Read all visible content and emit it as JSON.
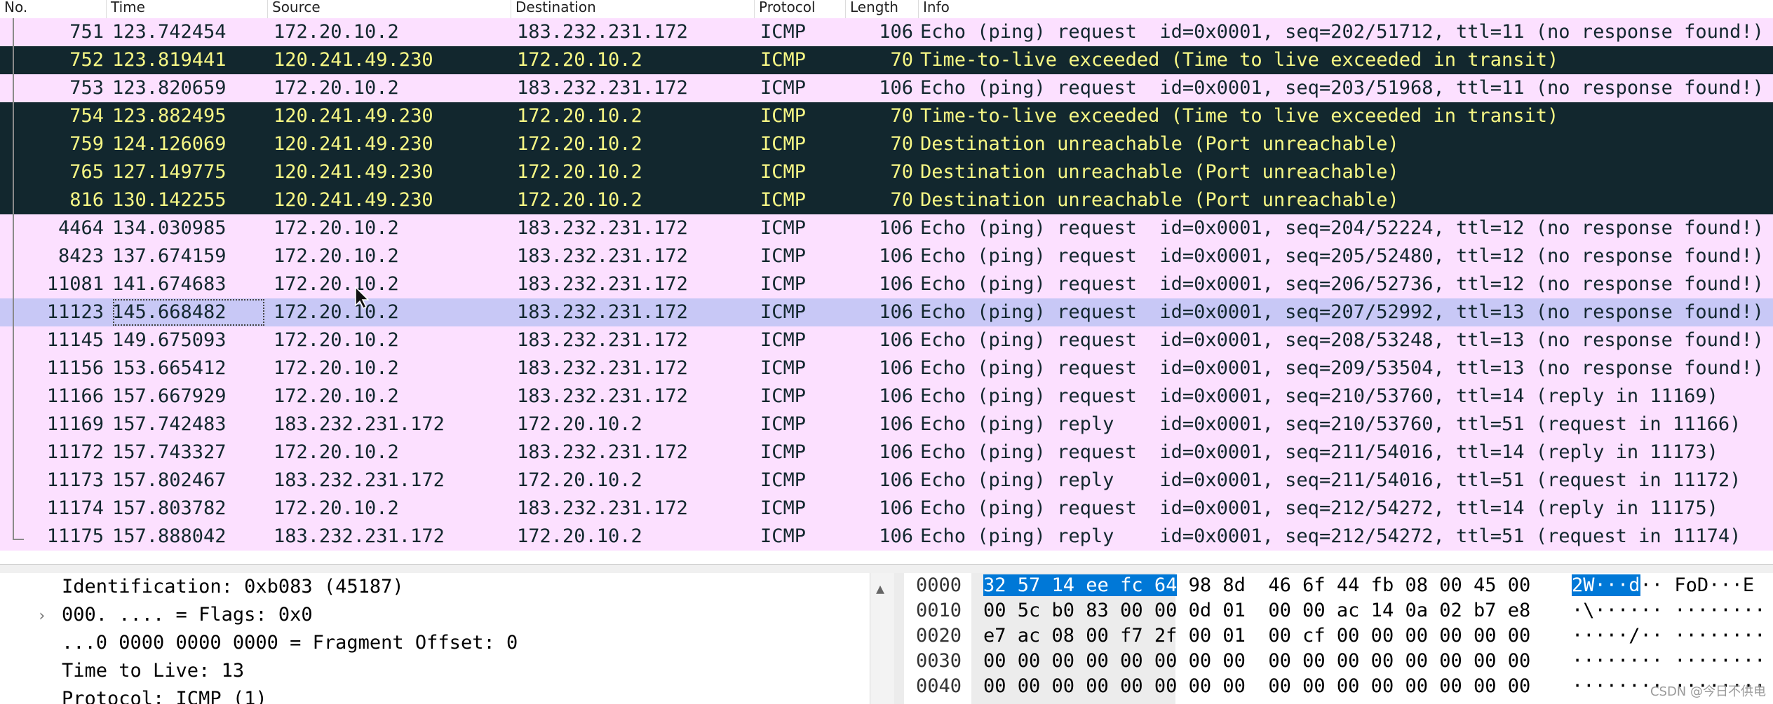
{
  "columns": {
    "no": "No.",
    "time": "Time",
    "source": "Source",
    "destination": "Destination",
    "protocol": "Protocol",
    "length": "Length",
    "info": "Info"
  },
  "packets": [
    {
      "no": "751",
      "time": "123.742454",
      "source": "172.20.10.2",
      "destination": "183.232.231.172",
      "protocol": "ICMP",
      "length": "106",
      "info": "Echo (ping) request  id=0x0001, seq=202/51712, ttl=11 (no response found!)",
      "kind": "echo"
    },
    {
      "no": "752",
      "time": "123.819441",
      "source": "120.241.49.230",
      "destination": "172.20.10.2",
      "protocol": "ICMP",
      "length": "70",
      "info": "Time-to-live exceeded (Time to live exceeded in transit)",
      "kind": "err"
    },
    {
      "no": "753",
      "time": "123.820659",
      "source": "172.20.10.2",
      "destination": "183.232.231.172",
      "protocol": "ICMP",
      "length": "106",
      "info": "Echo (ping) request  id=0x0001, seq=203/51968, ttl=11 (no response found!)",
      "kind": "echo"
    },
    {
      "no": "754",
      "time": "123.882495",
      "source": "120.241.49.230",
      "destination": "172.20.10.2",
      "protocol": "ICMP",
      "length": "70",
      "info": "Time-to-live exceeded (Time to live exceeded in transit)",
      "kind": "err"
    },
    {
      "no": "759",
      "time": "124.126069",
      "source": "120.241.49.230",
      "destination": "172.20.10.2",
      "protocol": "ICMP",
      "length": "70",
      "info": "Destination unreachable (Port unreachable)",
      "kind": "err"
    },
    {
      "no": "765",
      "time": "127.149775",
      "source": "120.241.49.230",
      "destination": "172.20.10.2",
      "protocol": "ICMP",
      "length": "70",
      "info": "Destination unreachable (Port unreachable)",
      "kind": "err"
    },
    {
      "no": "816",
      "time": "130.142255",
      "source": "120.241.49.230",
      "destination": "172.20.10.2",
      "protocol": "ICMP",
      "length": "70",
      "info": "Destination unreachable (Port unreachable)",
      "kind": "err"
    },
    {
      "no": "4464",
      "time": "134.030985",
      "source": "172.20.10.2",
      "destination": "183.232.231.172",
      "protocol": "ICMP",
      "length": "106",
      "info": "Echo (ping) request  id=0x0001, seq=204/52224, ttl=12 (no response found!)",
      "kind": "echo"
    },
    {
      "no": "8423",
      "time": "137.674159",
      "source": "172.20.10.2",
      "destination": "183.232.231.172",
      "protocol": "ICMP",
      "length": "106",
      "info": "Echo (ping) request  id=0x0001, seq=205/52480, ttl=12 (no response found!)",
      "kind": "echo"
    },
    {
      "no": "11081",
      "time": "141.674683",
      "source": "172.20.10.2",
      "destination": "183.232.231.172",
      "protocol": "ICMP",
      "length": "106",
      "info": "Echo (ping) request  id=0x0001, seq=206/52736, ttl=12 (no response found!)",
      "kind": "echo"
    },
    {
      "no": "11123",
      "time": "145.668482",
      "source": "172.20.10.2",
      "destination": "183.232.231.172",
      "protocol": "ICMP",
      "length": "106",
      "info": "Echo (ping) request  id=0x0001, seq=207/52992, ttl=13 (no response found!)",
      "kind": "selected"
    },
    {
      "no": "11145",
      "time": "149.675093",
      "source": "172.20.10.2",
      "destination": "183.232.231.172",
      "protocol": "ICMP",
      "length": "106",
      "info": "Echo (ping) request  id=0x0001, seq=208/53248, ttl=13 (no response found!)",
      "kind": "echo"
    },
    {
      "no": "11156",
      "time": "153.665412",
      "source": "172.20.10.2",
      "destination": "183.232.231.172",
      "protocol": "ICMP",
      "length": "106",
      "info": "Echo (ping) request  id=0x0001, seq=209/53504, ttl=13 (no response found!)",
      "kind": "echo"
    },
    {
      "no": "11166",
      "time": "157.667929",
      "source": "172.20.10.2",
      "destination": "183.232.231.172",
      "protocol": "ICMP",
      "length": "106",
      "info": "Echo (ping) request  id=0x0001, seq=210/53760, ttl=14 (reply in 11169)",
      "kind": "echo"
    },
    {
      "no": "11169",
      "time": "157.742483",
      "source": "183.232.231.172",
      "destination": "172.20.10.2",
      "protocol": "ICMP",
      "length": "106",
      "info": "Echo (ping) reply    id=0x0001, seq=210/53760, ttl=51 (request in 11166)",
      "kind": "echo"
    },
    {
      "no": "11172",
      "time": "157.743327",
      "source": "172.20.10.2",
      "destination": "183.232.231.172",
      "protocol": "ICMP",
      "length": "106",
      "info": "Echo (ping) request  id=0x0001, seq=211/54016, ttl=14 (reply in 11173)",
      "kind": "echo"
    },
    {
      "no": "11173",
      "time": "157.802467",
      "source": "183.232.231.172",
      "destination": "172.20.10.2",
      "protocol": "ICMP",
      "length": "106",
      "info": "Echo (ping) reply    id=0x0001, seq=211/54016, ttl=51 (request in 11172)",
      "kind": "echo"
    },
    {
      "no": "11174",
      "time": "157.803782",
      "source": "172.20.10.2",
      "destination": "183.232.231.172",
      "protocol": "ICMP",
      "length": "106",
      "info": "Echo (ping) request  id=0x0001, seq=212/54272, ttl=14 (reply in 11175)",
      "kind": "echo"
    },
    {
      "no": "11175",
      "time": "157.888042",
      "source": "183.232.231.172",
      "destination": "172.20.10.2",
      "protocol": "ICMP",
      "length": "106",
      "info": "Echo (ping) reply    id=0x0001, seq=212/54272, ttl=51 (request in 11174)",
      "kind": "echo"
    }
  ],
  "details": [
    {
      "text": "Identification: 0xb083 (45187)",
      "expandable": false
    },
    {
      "text": "000. .... = Flags: 0x0",
      "expandable": true
    },
    {
      "text": "...0 0000 0000 0000 = Fragment Offset: 0",
      "expandable": false
    },
    {
      "text": "Time to Live: 13",
      "expandable": false
    },
    {
      "text": "Protocol: ICMP (1)",
      "expandable": false
    }
  ],
  "bytes": [
    {
      "offset": "0000",
      "hex_hl": "32 57 14 ee fc 64",
      "hex": " 98 8d  46 6f 44 fb 08 00 45 00",
      "ascii_hl": "2W···d",
      "ascii": "·· FoD···E"
    },
    {
      "offset": "0010",
      "hex_hl": "",
      "hex": "00 5c b0 83 00 00 0d 01  00 00 ac 14 0a 02 b7 e8",
      "ascii_hl": "",
      "ascii": "·\\······ ········"
    },
    {
      "offset": "0020",
      "hex_hl": "",
      "hex": "e7 ac 08 00 f7 2f 00 01  00 cf 00 00 00 00 00 00",
      "ascii_hl": "",
      "ascii": "·····/·· ········"
    },
    {
      "offset": "0030",
      "hex_hl": "",
      "hex": "00 00 00 00 00 00 00 00  00 00 00 00 00 00 00 00",
      "ascii_hl": "",
      "ascii": "········ ········"
    },
    {
      "offset": "0040",
      "hex_hl": "",
      "hex": "00 00 00 00 00 00 00 00  00 00 00 00 00 00 00 00",
      "ascii_hl": "",
      "ascii": "········ ········"
    }
  ],
  "icons": {
    "expand": "chevron-right-icon",
    "scroll_up": "caret-up-icon",
    "cursor": "mouse-pointer-icon"
  },
  "colors": {
    "echo_row": "#fce0ff",
    "error_row": "#12272e",
    "error_text": "#f7f785",
    "selected_row": "#c8c8f6",
    "byte_highlight": "#0078d7"
  },
  "watermark": "CSDN @今日不供电"
}
